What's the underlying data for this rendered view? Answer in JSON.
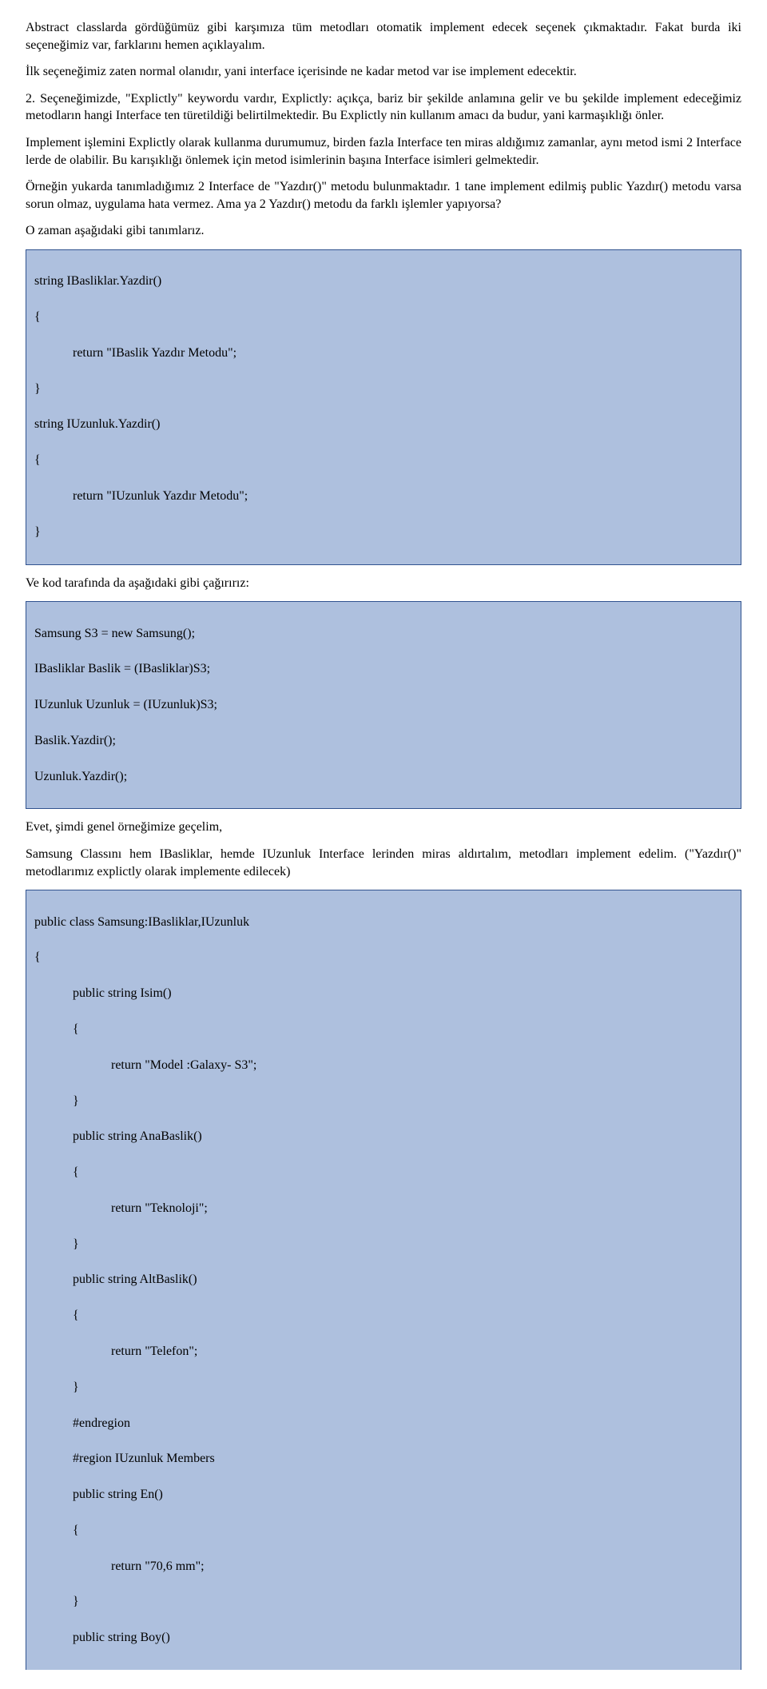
{
  "para1": "Abstract classlarda gördüğümüz gibi karşımıza tüm metodları otomatik implement edecek seçenek çıkmaktadır. Fakat burda iki seçeneğimiz var, farklarını hemen açıklayalım.",
  "para2": "İlk seçeneğimiz zaten normal olanıdır, yani interface içerisinde ne kadar metod var ise implement edecektir.",
  "para3": "2. Seçeneğimizde, \"Explictly\" keywordu vardır, Explictly: açıkça, bariz bir şekilde anlamına gelir ve bu şekilde implement edeceğimiz metodların hangi Interface ten türetildiği belirtilmektedir. Bu Explictly nin kullanım amacı da budur, yani karmaşıklığı önler.",
  "para4": "Implement işlemini Explictly olarak kullanma durumumuz, birden fazla Interface ten miras aldığımız zamanlar, aynı metod ismi 2 Interface lerde de olabilir. Bu karışıklığı önlemek için metod isimlerinin başına Interface isimleri gelmektedir.",
  "para5": "Örneğin yukarda tanımladığımız 2 Interface de \"Yazdır()\" metodu bulunmaktadır. 1 tane implement edilmiş public Yazdır() metodu varsa sorun olmaz, uygulama hata vermez. Ama ya 2 Yazdır() metodu da farklı işlemler yapıyorsa?",
  "para6": "O zaman aşağıdaki gibi tanımlarız.",
  "code1": {
    "l1": "string IBasliklar.Yazdir()",
    "l2": "{",
    "l3": "return \"IBaslik Yazdır Metodu\";",
    "l4": "}",
    "l5": "string IUzunluk.Yazdir()",
    "l6": "{",
    "l7": "return \"IUzunluk Yazdır Metodu\";",
    "l8": "}"
  },
  "para7": "Ve kod tarafında da aşağıdaki gibi çağırırız:",
  "code2": {
    "l1": "Samsung S3 = new Samsung();",
    "l2": "IBasliklar Baslik = (IBasliklar)S3;",
    "l3": "IUzunluk Uzunluk = (IUzunluk)S3;",
    "l4": "Baslik.Yazdir();",
    "l5": "Uzunluk.Yazdir();"
  },
  "para8": "Evet, şimdi genel örneğimize geçelim,",
  "para9": "Samsung Classını hem IBasliklar, hemde IUzunluk Interface lerinden miras aldırtalım, metodları implement edelim. (\"Yazdır()\" metodlarımız explictly olarak implemente edilecek)",
  "code3": {
    "l1": "public class Samsung:IBasliklar,IUzunluk",
    "l2": "{",
    "l3": "public string Isim()",
    "l4": "{",
    "l5": "return \"Model :Galaxy- S3\";",
    "l6": "}",
    "l7": "public string AnaBaslik()",
    "l8": "{",
    "l9": "return \"Teknoloji\";",
    "l10": "}",
    "l11": "public string AltBaslik()",
    "l12": "{",
    "l13": "return \"Telefon\";",
    "l14": "}",
    "l15": "#endregion",
    "l16": "#region IUzunluk Members",
    "l17": "public string En()",
    "l18": "{",
    "l19": "return \"70,6 mm\";",
    "l20": "}",
    "l21": "public string Boy()"
  }
}
